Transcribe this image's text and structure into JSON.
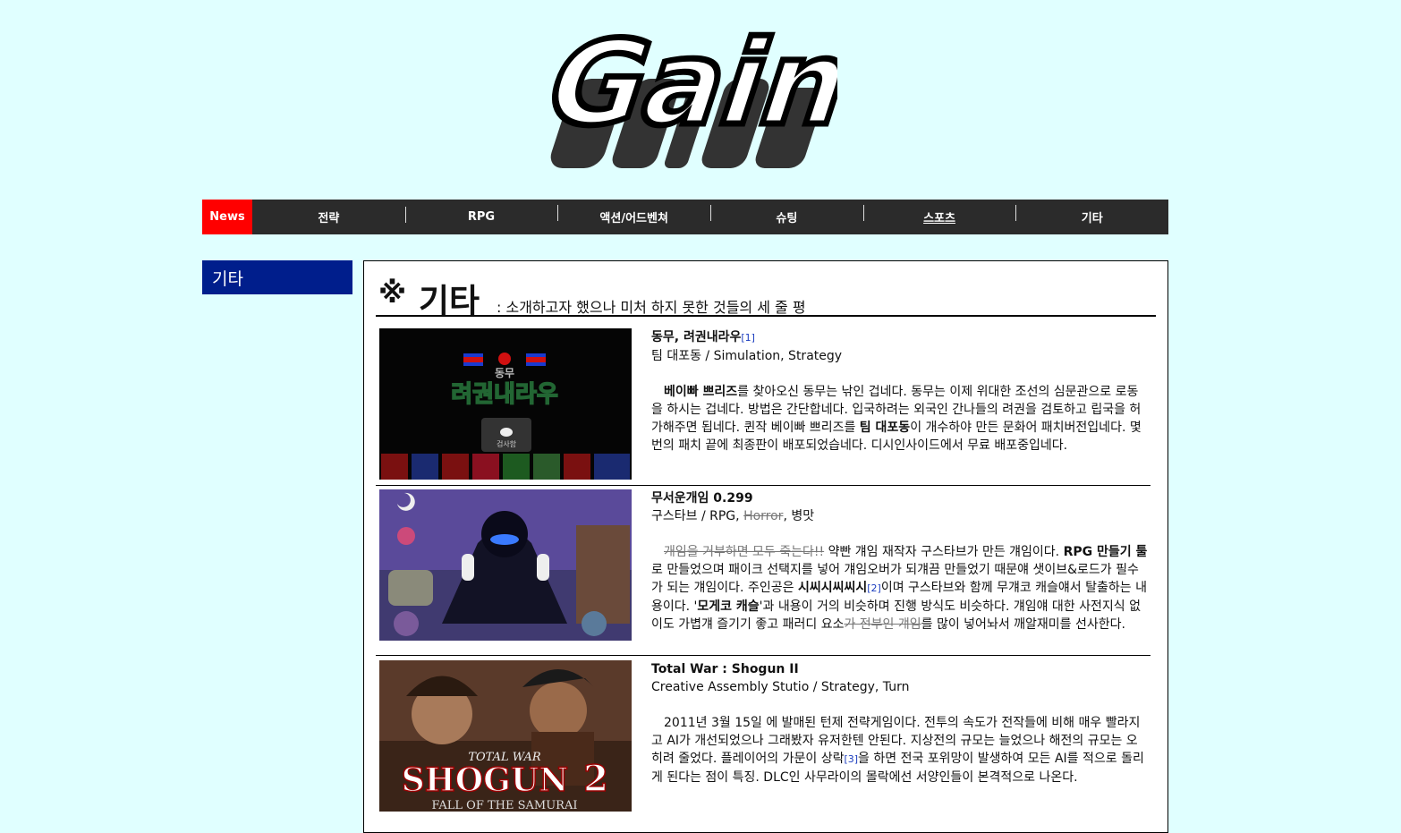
{
  "logo": {
    "text": "Gaint"
  },
  "nav": {
    "news": "News",
    "items": [
      "전략",
      "RPG",
      "액션/어드벤쳐",
      "슈팅",
      "스포츠",
      "기타"
    ]
  },
  "sidebar": {
    "title": "기타"
  },
  "main": {
    "mark": "※",
    "title": "기타",
    "subtitle": ": 소개하고자 했으나 미처 하지 못한 것들의 세 줄 평",
    "entries": [
      {
        "name": "동무, 려권내라우",
        "footnote": "[1]",
        "meta": "팀 대포동 / Simulation, Strategy",
        "body_bold1": "베이빠 쁘리즈",
        "body_part1": "를 찾아오신 동무는 낚인 겁네다. 동무는 이제 위대한 조선의 심문관으로 로동을 하시는 겁네다. 방법은 간단합네다. 입국하려는 외국인 간나들의 려권을 검토하고 립국을 허가해주면 됩네다. 퀸작 베이빠 쁘리즈를 ",
        "body_bold2": "팀 대포동",
        "body_part2": "이 개수하야 만든 문화어 패치버전입네다. 몇 번의 패치 끝에 최종판이 배포되었습네다. 디시인사이드에서 무료 배포중입네다.",
        "thumb_title_small": "동무",
        "thumb_title": "려권내라우",
        "thumb_button": "검사함"
      },
      {
        "name": "무서운개임 0.299",
        "meta_prefix": "구스타브 / RPG, ",
        "meta_strike": "Horror",
        "meta_suffix": ", 병맛",
        "body_strike1": "개임을 거부하면 모두 죽는다!!",
        "body_part1": " 약빤 걔임 재작자 구스타브가 만든 걔임이다. ",
        "body_bold1": "RPG 만들기 툴",
        "body_part2": "로 만들었으며 패이크 선택지를 넣어 걔임오버가 되걔끔 만들었기 때문얘 샛이브&로드가 필수가 되는 걔임이다. 주인공은 ",
        "body_bold2": "시씨시씨씨시",
        "footnote": "[2]",
        "body_part3": "이며 구스타브와 함께 무걔코 캐슬얘서 탈출하는 내용이다. '",
        "body_bold3": "모게코 캐슬",
        "body_part4": "'과 내용이 거의 비슷하며 진행 방식도 비슷하다. 걔임얘 대한 사전지식 없이도 가볍걔 즐기기 좋고 패러디 요소",
        "body_strike2": "가 전부인 걔임",
        "body_part5": "를 많이 넣어놔서 깨알재미를 선사한다."
      },
      {
        "name": "Total War : Shogun II",
        "meta": "Creative Assembly Stutio / Strategy, Turn",
        "body_part1": "2011년 3월 15일 에 발매된 턴제 전략게임이다. 전투의 속도가 전작들에 비해 매우 빨라지고 AI가 개선되었으나 그래봤자 유저한텐 안된다. 지상전의 규모는 늘었으나 해전의 규모는 오히려 줄었다. 플레이어의 가문이 상락",
        "footnote": "[3]",
        "body_part2": "을 하면 전국 포위망이 발생하여 모든 AI를 적으로 돌리게 된다는 점이 특징. DLC인 사무라이의 몰락에선 서양인들이 본격적으로 나온다.",
        "thumb_text1": "TOTAL WAR",
        "thumb_text2": "SHOGUN",
        "thumb_text3": "2",
        "thumb_text4": "FALL OF THE SAMURAI"
      }
    ]
  }
}
